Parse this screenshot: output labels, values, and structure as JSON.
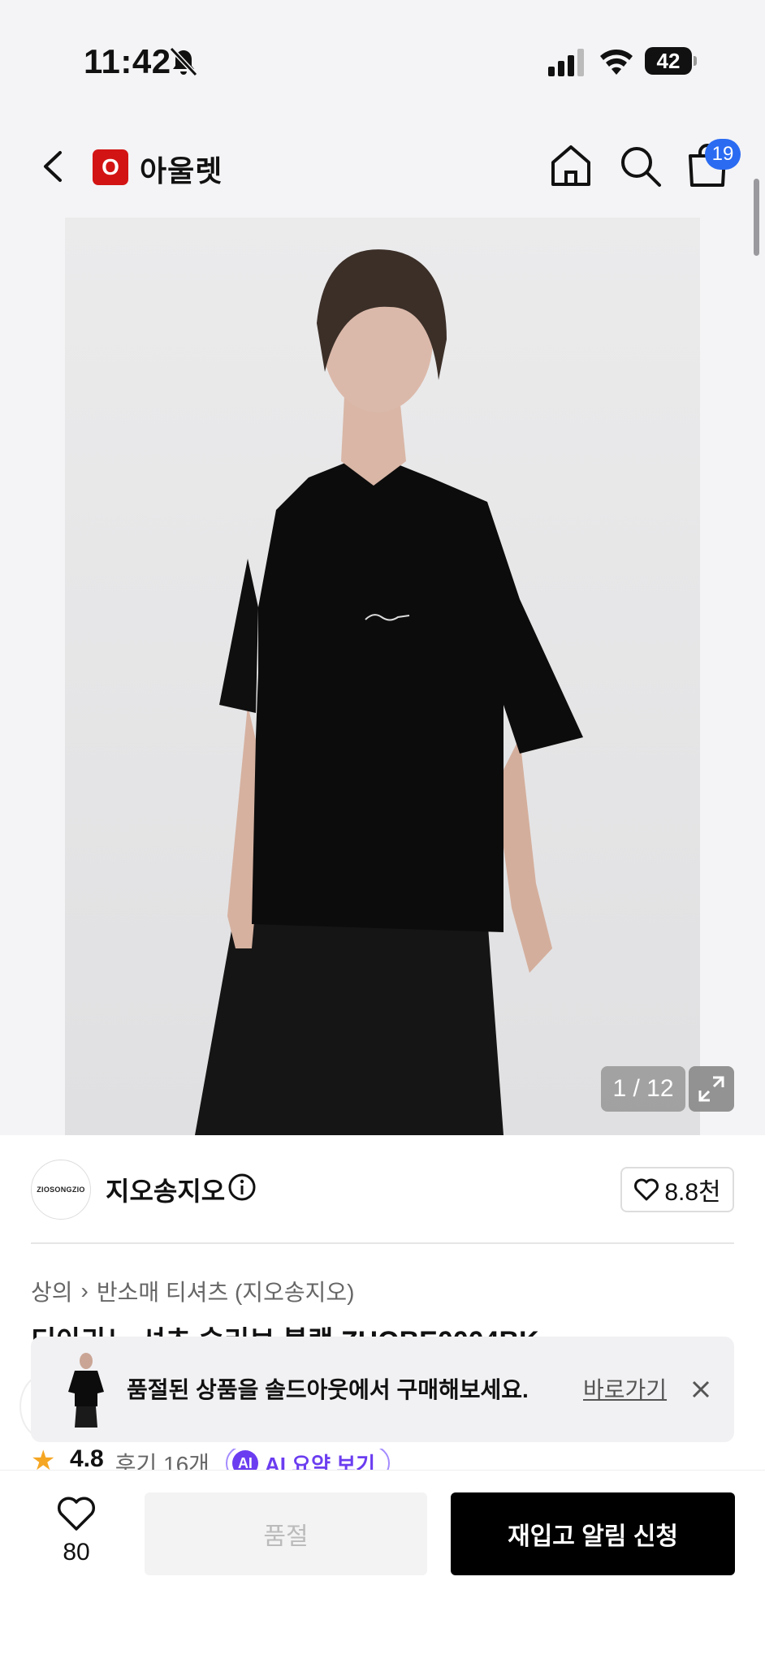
{
  "status_bar": {
    "time": "11:42",
    "battery": "42"
  },
  "header": {
    "brand_logo_letter": "O",
    "brand_name": "아울렛",
    "cart_count": "19"
  },
  "gallery": {
    "counter": "1 / 12"
  },
  "seller": {
    "logo_text": "ZIOSONGZIO",
    "name": "지오송지오",
    "likes": "8.8천"
  },
  "breadcrumb": {
    "category": "상의",
    "sub_category": "반소매 티셔츠 (지오송지오)"
  },
  "product": {
    "title": "디아라노 셔츠 슬리브 블랙 ZHOBE0004BK"
  },
  "toast": {
    "message": "품절된 상품을 솔드아웃에서 구매해보세요.",
    "link": "바로가기"
  },
  "rating": {
    "score": "4.8",
    "reviews": "후기 16개",
    "ai_badge": "AI",
    "ai_summary": "AI 요약 보기"
  },
  "bottom_bar": {
    "wish_count": "80",
    "soldout_label": "품절",
    "restock_label": "재입고 알림 신청"
  },
  "colors": {
    "brand_red": "#d31414",
    "badge_blue": "#2a6bf2",
    "ai_purple": "#6b3df0"
  }
}
